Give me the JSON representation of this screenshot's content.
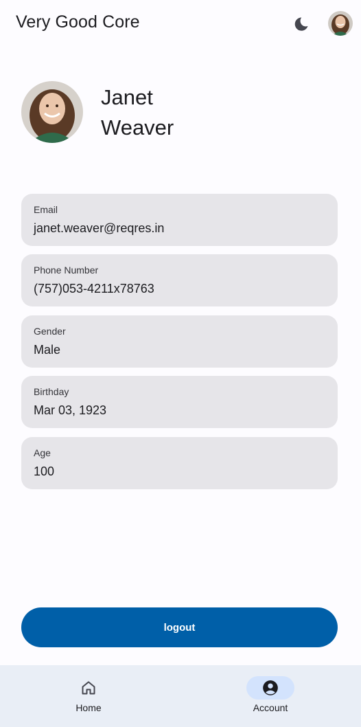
{
  "appbar": {
    "title": "Very Good Core",
    "theme_icon": "moon-icon",
    "avatar_icon": "user-avatar"
  },
  "profile": {
    "first_name": "Janet",
    "last_name": "Weaver",
    "avatar": "profile-photo"
  },
  "fields": {
    "email": {
      "label": "Email",
      "value": "janet.weaver@reqres.in"
    },
    "phone": {
      "label": "Phone Number",
      "value": "(757)053-4211x78763"
    },
    "gender": {
      "label": "Gender",
      "value": "Male"
    },
    "birthday": {
      "label": "Birthday",
      "value": "Mar 03, 1923"
    },
    "age": {
      "label": "Age",
      "value": "100"
    }
  },
  "logout_label": "logout",
  "nav": {
    "items": [
      {
        "label": "Home",
        "icon": "home-icon",
        "active": false
      },
      {
        "label": "Account",
        "icon": "account-circle-icon",
        "active": true
      }
    ]
  },
  "colors": {
    "background": "#fdfcff",
    "card": "#e6e5e9",
    "primary": "#005fa8",
    "nav_background": "#e9eef6",
    "nav_active_pill": "#d3e3fd"
  }
}
